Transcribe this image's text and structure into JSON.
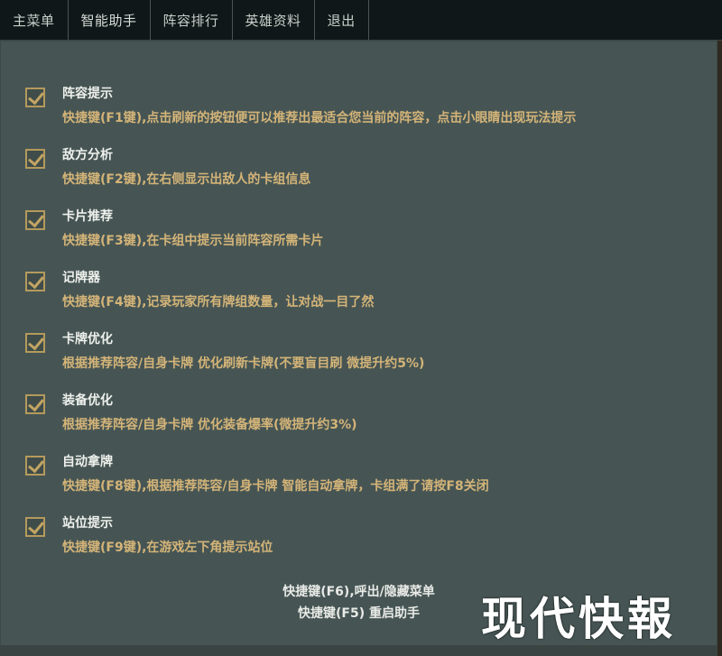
{
  "topbar": {
    "tabs": [
      {
        "label": "主菜单"
      },
      {
        "label": "智能助手"
      },
      {
        "label": "阵容排行"
      },
      {
        "label": "英雄资料"
      },
      {
        "label": "退出"
      }
    ],
    "active_tab": "智能助手"
  },
  "options": [
    {
      "title": "阵容提示",
      "desc": "快捷键(F1键),点击刷新的按钮便可以推荐出最适合您当前的阵容，点击小眼睛出现玩法提示",
      "checked": true
    },
    {
      "title": "敌方分析",
      "desc": "快捷键(F2键),在右侧显示出敌人的卡组信息",
      "checked": true
    },
    {
      "title": "卡片推荐",
      "desc": "快捷键(F3键),在卡组中提示当前阵容所需卡片",
      "checked": true
    },
    {
      "title": "记牌器",
      "desc": "快捷键(F4键),记录玩家所有牌组数量，让对战一目了然",
      "checked": true
    },
    {
      "title": "卡牌优化",
      "desc": "根据推荐阵容/自身卡牌 优化刷新卡牌(不要盲目刷 微提升约5%)",
      "checked": true
    },
    {
      "title": "装备优化",
      "desc": "根据推荐阵容/自身卡牌 优化装备爆率(微提升约3%)",
      "checked": true
    },
    {
      "title": "自动拿牌",
      "desc": "快捷键(F8键),根据推荐阵容/自身卡牌 智能自动拿牌，卡组满了请按F8关闭",
      "checked": true
    },
    {
      "title": "站位提示",
      "desc": "快捷键(F9键),在游戏左下角提示站位",
      "checked": true
    }
  ],
  "footer": {
    "line1": "快捷键(F6),呼出/隐藏菜单",
    "line2": "快捷键(F5) 重启助手"
  },
  "watermark": "现代快報",
  "colors": {
    "panel_bg": "#465554",
    "topbar_bg": "#0f1718",
    "title_text": "#eef0ec",
    "desc_text": "#d4b478",
    "checkbox_accent": "#c2a463"
  }
}
